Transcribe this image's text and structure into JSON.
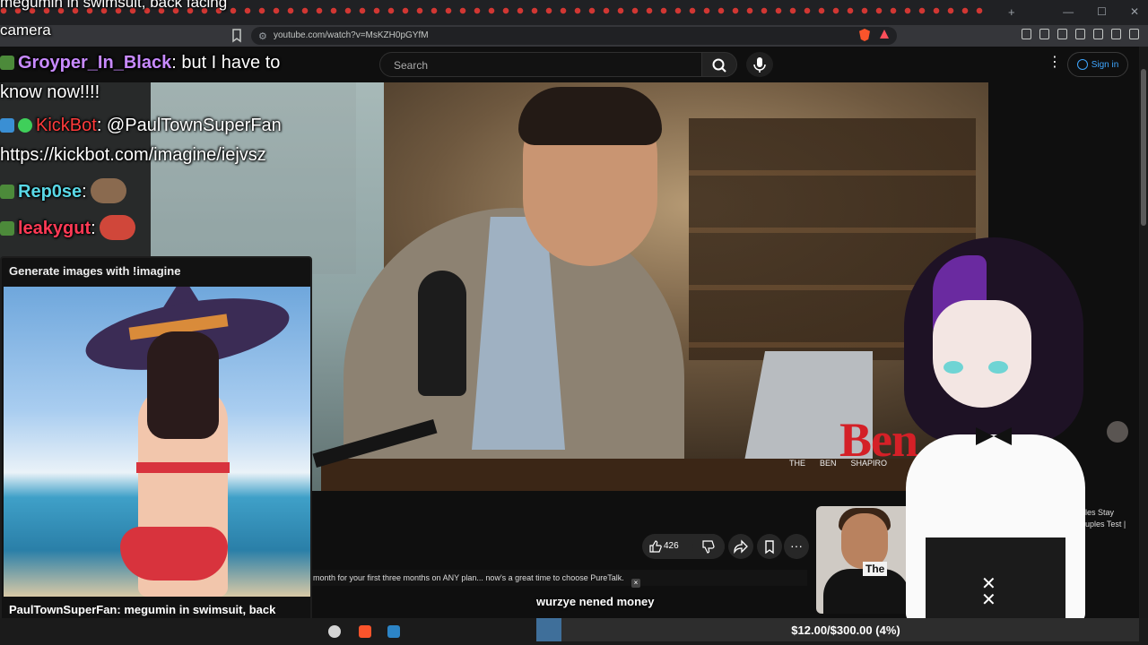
{
  "browser": {
    "url": "youtube.com/watch?v=MsKZH0pGYfM",
    "new_tab": "+",
    "window_controls": [
      "—",
      "☐",
      "✕"
    ]
  },
  "youtube": {
    "search_placeholder": "Search",
    "sign_in": "Sign in",
    "more": "⋮",
    "like_count": "426",
    "more_actions": "···",
    "description_snippet": "month for your first three months on ANY plan... now's a great time to choose PureTalk.",
    "rec_thumb_label": "The",
    "rec_title_line1": "les Stay",
    "rec_title_line2": "uples Test |",
    "video_logo": "Ben",
    "video_logo_sub": [
      "THE",
      "BEN",
      "SHAPIRO"
    ]
  },
  "overlay": {
    "top_text_line1": "megumin in swimsuit, back facing",
    "top_text_line2": "camera",
    "chat": [
      {
        "user": "Groyper_In_Black",
        "sep": ":",
        "message": " but I have to"
      },
      {
        "message": "know now!!!!"
      },
      {
        "user": "KickBot",
        "sep": ":",
        "message": " @PaulTownSuperFan"
      },
      {
        "message": "https://kickbot.com/imagine/iejvsz"
      },
      {
        "user": "Rep0se",
        "sep": ":"
      },
      {
        "user": "leakygut",
        "sep": ":"
      }
    ],
    "imagine_header": "Generate images with !imagine",
    "imagine_caption": "PaulTownSuperFan: megumin in swimsuit, back facing camera",
    "tts_text": "wurzye nened money",
    "goal_text": "$12.00/$300.00 (4%)",
    "goal_fraction": 0.04
  },
  "colors": {
    "accent_blue": "#3ea6ff",
    "kickbot_red": "#ff3b3b",
    "groyper_purple": "#c88aff",
    "rep0se_teal": "#59d8e6"
  }
}
